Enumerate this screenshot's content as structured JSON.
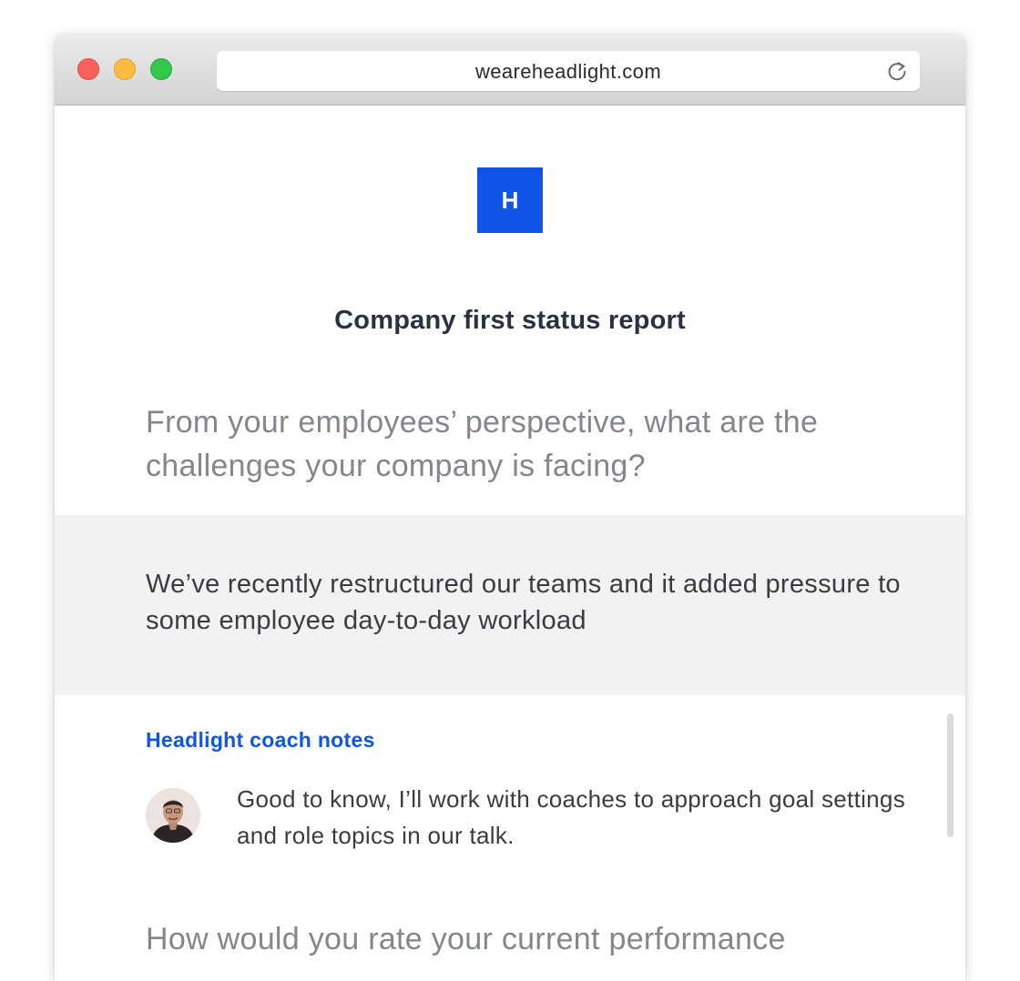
{
  "browser": {
    "url": "weareheadlight.com",
    "reload_icon": "reload-icon"
  },
  "page": {
    "logo_letter": "H",
    "logo_color": "#1155e8",
    "title": "Company first status report",
    "question_1": "From your employees’ perspective, what are the challenges your company is facing?",
    "answer_1": "We’ve recently restructured our teams and it added pressure to some employee day-to-day workload",
    "coach": {
      "heading": "Headlight coach notes",
      "note": "Good to know, I’ll work with coaches to approach goal settings and role topics in our talk.",
      "avatar_icon": "coach-avatar"
    },
    "question_2": "How would you rate your current performance"
  },
  "colors": {
    "accent": "#1155e8",
    "answer_background": "#f2f2f2",
    "question_text": "#83868d",
    "body_text": "#3a3c42"
  }
}
